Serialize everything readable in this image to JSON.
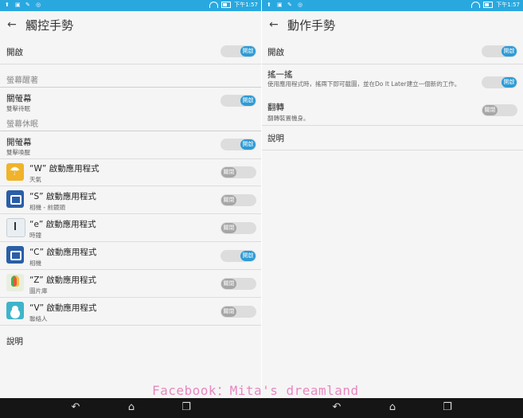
{
  "status": {
    "time": "下午1:57"
  },
  "left": {
    "title": "觸控手勢",
    "master": {
      "label": "開啟",
      "toggle": "開啟"
    },
    "section1": "螢幕醒著",
    "close_screen": {
      "label": "關螢幕",
      "sub": "雙擊待眠",
      "toggle": "開啟"
    },
    "section2": "螢幕休眠",
    "open_screen": {
      "label": "開螢幕",
      "sub": "雙擊喚醒",
      "toggle": "開啟"
    },
    "apps": [
      {
        "label": "“W” 啟動應用程式",
        "sub": "天氣",
        "toggle": "關閉",
        "icon": "weather-icon"
      },
      {
        "label": "“S” 啟動應用程式",
        "sub": "相機 - 前鏡頭",
        "toggle": "關閉",
        "icon": "camera-icon"
      },
      {
        "label": "“e” 啟動應用程式",
        "sub": "時鐘",
        "toggle": "關閉",
        "icon": "clock-icon"
      },
      {
        "label": "“C” 啟動應用程式",
        "sub": "相機",
        "toggle": "開啟",
        "icon": "camera-icon"
      },
      {
        "label": "“Z” 啟動應用程式",
        "sub": "圖片庫",
        "toggle": "關閉",
        "icon": "gallery-icon"
      },
      {
        "label": "“V” 啟動應用程式",
        "sub": "聯絡人",
        "toggle": "關閉",
        "icon": "contacts-icon"
      }
    ],
    "help": "說明"
  },
  "right": {
    "title": "動作手勢",
    "master": {
      "label": "開啟",
      "toggle": "開啟"
    },
    "shake": {
      "label": "搖一搖",
      "sub": "使用應用程式時，搖兩下即可截圖，並在Do It Later建立一個新的工作。",
      "toggle": "開啟"
    },
    "flip": {
      "label": "翻轉",
      "sub": "翻轉裝置機身。",
      "toggle": "關閉"
    },
    "help": "說明"
  },
  "watermark": "Facebook：Mita's dreamland",
  "colors": {
    "statusbar": "#29a8e0",
    "toggle_on": "#2d9bd6",
    "toggle_off": "#a6a6a6",
    "watermark": "#e887c0"
  }
}
